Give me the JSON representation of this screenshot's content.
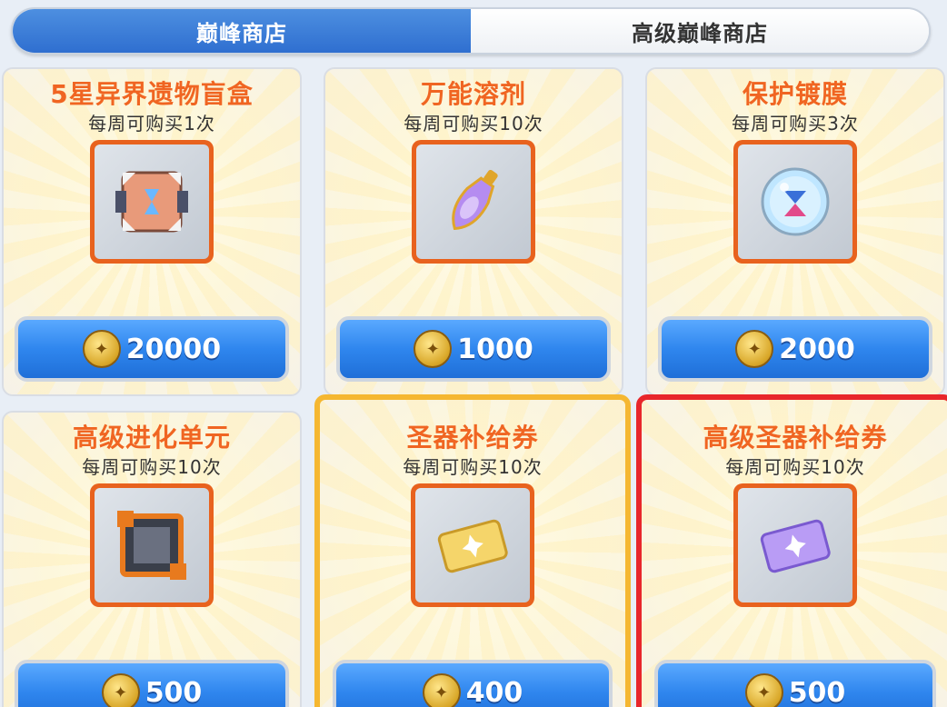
{
  "tabs": [
    {
      "label": "巅峰商店",
      "active": true
    },
    {
      "label": "高级巅峰商店",
      "active": false
    }
  ],
  "items": [
    {
      "title": "5星异界遗物盲盒",
      "limit": "每周可购买1次",
      "price": "20000",
      "icon": "relic-box-icon"
    },
    {
      "title": "万能溶剂",
      "limit": "每周可购买10次",
      "price": "1000",
      "icon": "potion-bottle-icon"
    },
    {
      "title": "保护镀膜",
      "limit": "每周可购买3次",
      "price": "2000",
      "icon": "protective-orb-icon"
    },
    {
      "title": "高级进化单元",
      "limit": "每周可购买10次",
      "price": "500",
      "icon": "evolution-unit-icon"
    },
    {
      "title": "圣器补给券",
      "limit": "每周可购买10次",
      "price": "400",
      "icon": "gold-ticket-icon",
      "highlight": "#f5b731"
    },
    {
      "title": "高级圣器补给券",
      "limit": "每周可购买10次",
      "price": "500",
      "icon": "purple-ticket-icon",
      "highlight": "#e8262b"
    }
  ],
  "currency_icon": "coin-icon",
  "colors": {
    "accent": "#2f86ee",
    "title": "#f06522",
    "frame": "#e8621e"
  }
}
